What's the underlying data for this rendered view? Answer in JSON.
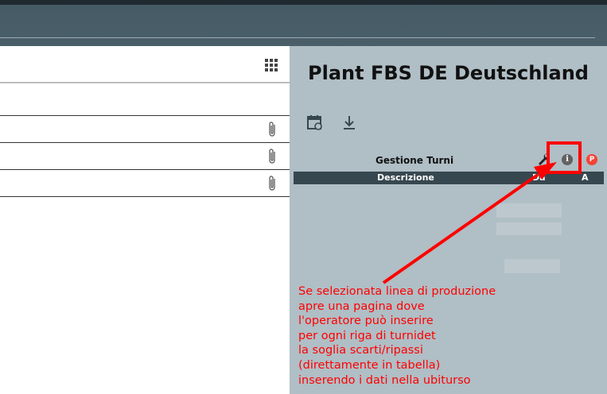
{
  "plant": {
    "title": "Plant FBS DE Deutschland"
  },
  "toolbar": {
    "icons": [
      "calendar-refresh-icon",
      "download-icon"
    ]
  },
  "section": {
    "title": "Gestione Turni",
    "icons": [
      "wrench-icon",
      "info-icon",
      "p-icon"
    ],
    "p_label": "P",
    "info_label": "i"
  },
  "table": {
    "columns": [
      "Descrizione",
      "Da",
      "A"
    ]
  },
  "left_list": {
    "rows": [
      "",
      "",
      ""
    ],
    "row_icon": "paperclip-icon",
    "header_icon": "apps-grid-icon"
  },
  "annotation": {
    "text": "Se selezionata linea di produzione\napre una pagina dove\nl'operatore può inserire\nper ogni riga di turnidet\nla soglia scarti/ripassi\n(direttamente in tabella)\ninserendo i dati nella ubiturso",
    "color": "#ff0000"
  },
  "colors": {
    "right_panel_bg": "#b0bec5",
    "table_header_bg": "#37474f",
    "topbar_bg": "#455a64"
  }
}
